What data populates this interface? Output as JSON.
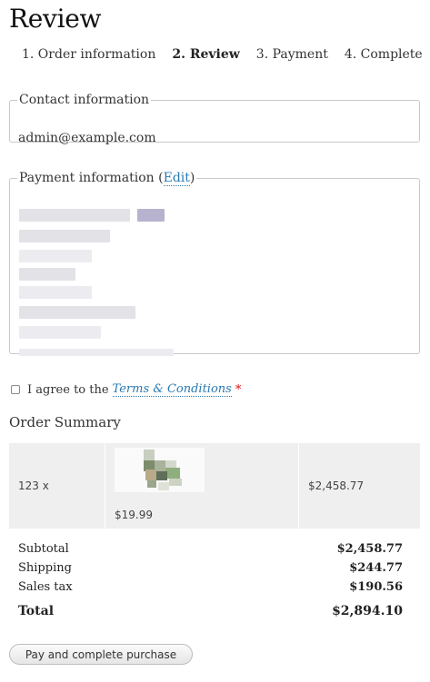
{
  "page": {
    "title": "Review"
  },
  "steps": [
    {
      "label": "1. Order information",
      "active": false
    },
    {
      "label": "2. Review",
      "active": true
    },
    {
      "label": "3. Payment",
      "active": false
    },
    {
      "label": "4. Complete",
      "active": false
    }
  ],
  "contact": {
    "legend": "Contact information",
    "email": "admin@example.com"
  },
  "payment": {
    "legend_prefix": "Payment information (",
    "edit_link": "Edit",
    "legend_suffix": ")"
  },
  "agreement": {
    "text": "I agree to the",
    "terms_link": "Terms & Conditions",
    "required_mark": "*"
  },
  "order_summary": {
    "heading": "Order Summary",
    "items": [
      {
        "quantity": "123 x",
        "unit_price": "$19.99",
        "line_total": "$2,458.77"
      }
    ],
    "totals": [
      {
        "label": "Subtotal",
        "value": "$2,458.77"
      },
      {
        "label": "Shipping",
        "value": "$244.77"
      },
      {
        "label": "Sales tax",
        "value": "$190.56"
      }
    ],
    "grand_total": {
      "label": "Total",
      "value": "$2,894.10"
    }
  },
  "actions": {
    "pay_button": "Pay and complete purchase"
  }
}
